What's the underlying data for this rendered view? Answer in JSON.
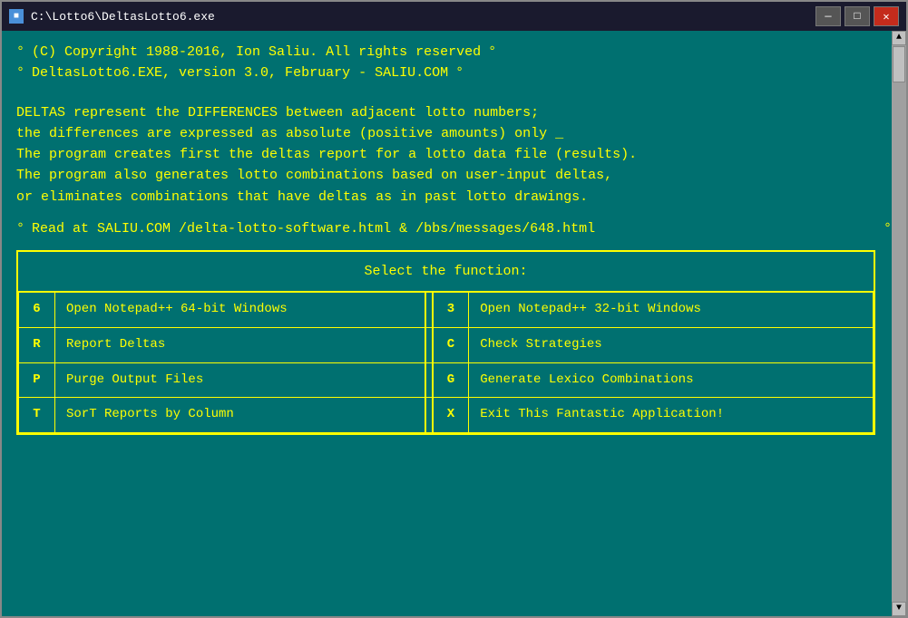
{
  "titleBar": {
    "title": "C:\\Lotto6\\DeltasLotto6.exe",
    "minimizeLabel": "—",
    "maximizeLabel": "□",
    "closeLabel": "✕"
  },
  "content": {
    "line1": "(C) Copyright 1988-2016, Ion Saliu. All rights reserved",
    "line2": "DeltasLotto6.EXE, version 3.0, February - SALIU.COM",
    "desc1": "DELTAS represent the DIFFERENCES between adjacent lotto numbers;",
    "desc2": "the differences are expressed as absolute (positive amounts) only _",
    "desc3": "The program creates first the deltas report for a lotto data file (results).",
    "desc4": "The program also generates lotto combinations based on user-input deltas,",
    "desc5": "or eliminates combinations that have deltas as in past lotto drawings.",
    "readLine": "Read at SALIU.COM /delta-lotto-software.html & /bbs/messages/648.html",
    "menuTitle": "Select the function:",
    "menuItems": [
      {
        "key": "6",
        "label": "Open Notepad++ 64-bit Windows",
        "key2": "3",
        "label2": "Open Notepad++ 32-bit Windows"
      },
      {
        "key": "R",
        "label": "Report Deltas",
        "key2": "C",
        "label2": "Check Strategies"
      },
      {
        "key": "P",
        "label": "Purge Output Files",
        "key2": "G",
        "label2": "Generate Lexico Combinations"
      },
      {
        "key": "T",
        "label": "SorT Reports by Column",
        "key2": "X",
        "label2": "Exit This Fantastic Application!"
      }
    ]
  }
}
